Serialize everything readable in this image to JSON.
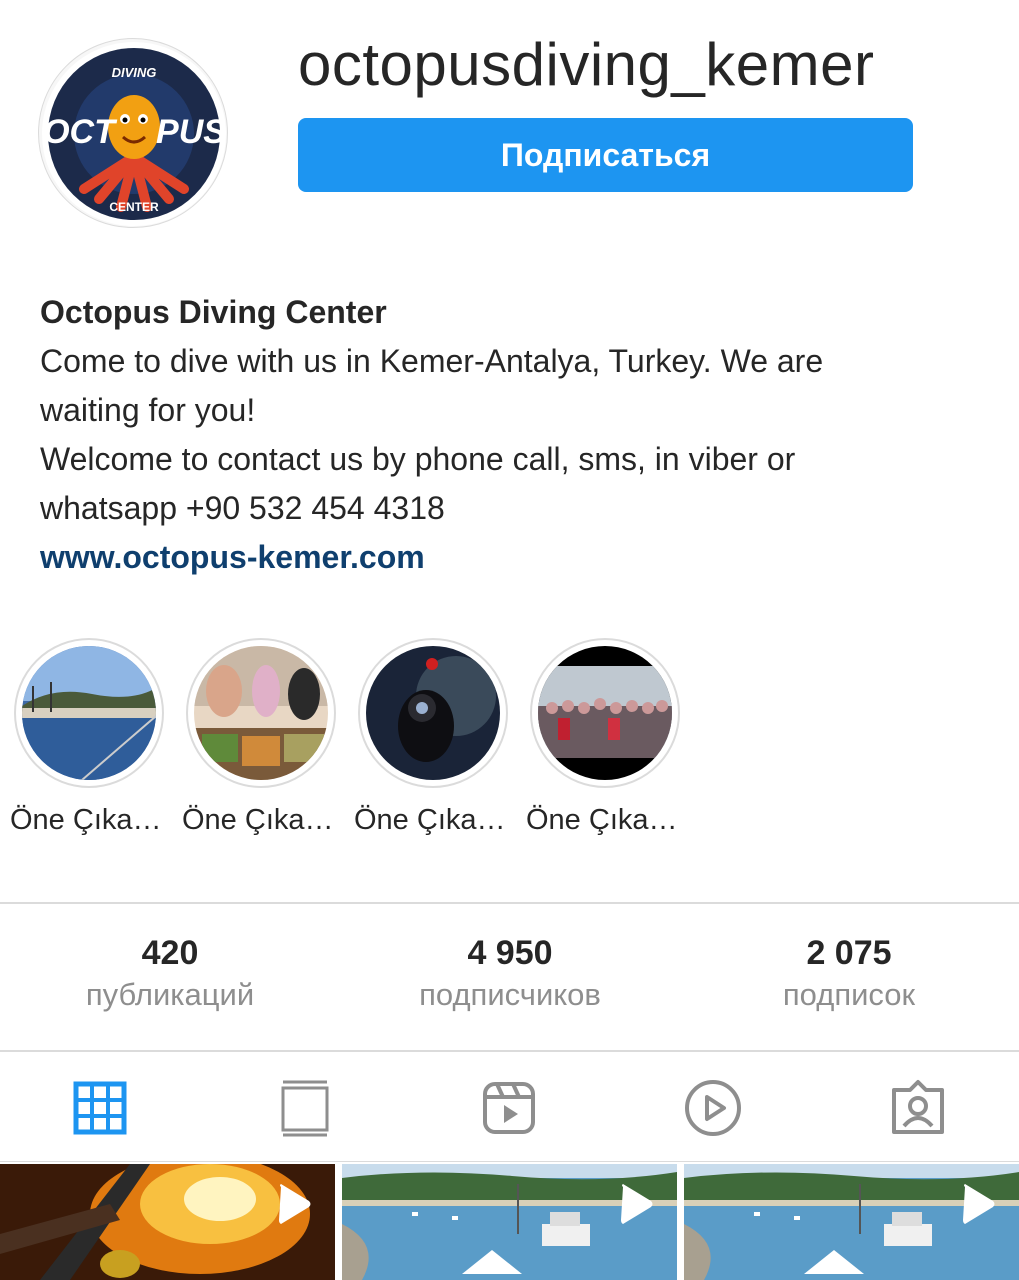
{
  "profile": {
    "username": "octopusdiving_kemer",
    "subscribe_label": "Подписаться",
    "display_name": "Octopus Diving Center",
    "bio_line1": "Come to dive with us in Kemer-Antalya, Turkey. We are waiting for you!",
    "bio_line2": "Welcome to contact us by phone call, sms, in viber or whatsapp +90 532 454 4318",
    "website": "www.octopus-kemer.com",
    "logo": {
      "top_text": "DIVING",
      "left_text": "OCT",
      "right_text": "PUS",
      "bottom_text": "CENTER"
    }
  },
  "highlights": [
    {
      "label": "Öne Çıkanlar"
    },
    {
      "label": "Öne Çıkanlar"
    },
    {
      "label": "Öne Çıkanlar"
    },
    {
      "label": "Öne Çıkanlar"
    }
  ],
  "stats": {
    "posts": {
      "value": "420",
      "label": "публикаций"
    },
    "followers": {
      "value": "4 950",
      "label": "подписчиков"
    },
    "following": {
      "value": "2 075",
      "label": "подписок"
    }
  },
  "tabs": [
    {
      "icon": "grid-icon",
      "active": true
    },
    {
      "icon": "feed-icon",
      "active": false
    },
    {
      "icon": "reels-icon",
      "active": false
    },
    {
      "icon": "video-play-icon",
      "active": false
    },
    {
      "icon": "tagged-icon",
      "active": false
    }
  ],
  "colors": {
    "accent": "#1d95f1",
    "active_tab": "#1d95f1",
    "inactive_tab": "#8e8e8e",
    "link": "#0f3f6e"
  }
}
